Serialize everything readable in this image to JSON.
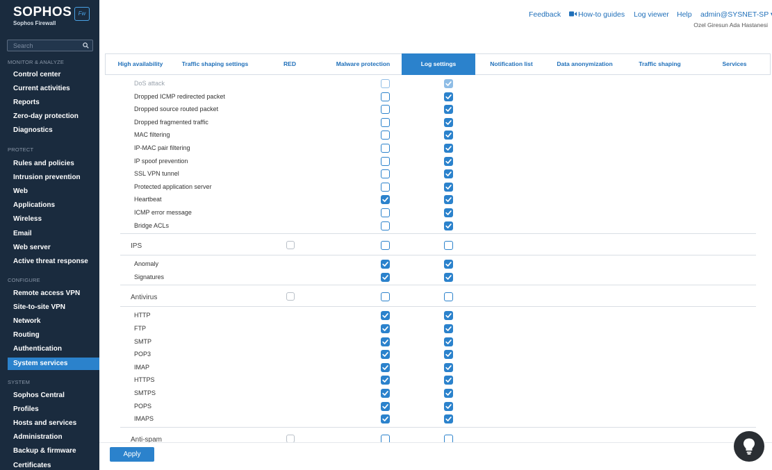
{
  "brand": {
    "name": "SOPHOS",
    "product": "Sophos Firewall",
    "badge": "Fw"
  },
  "search": {
    "placeholder": "Search"
  },
  "sidebar": {
    "sections": [
      {
        "label": "MONITOR & ANALYZE",
        "items": [
          "Control center",
          "Current activities",
          "Reports",
          "Zero-day protection",
          "Diagnostics"
        ]
      },
      {
        "label": "PROTECT",
        "items": [
          "Rules and policies",
          "Intrusion prevention",
          "Web",
          "Applications",
          "Wireless",
          "Email",
          "Web server",
          "Active threat response"
        ]
      },
      {
        "label": "CONFIGURE",
        "items": [
          "Remote access VPN",
          "Site-to-site VPN",
          "Network",
          "Routing",
          "Authentication",
          "System services"
        ]
      },
      {
        "label": "SYSTEM",
        "items": [
          "Sophos Central",
          "Profiles",
          "Hosts and services",
          "Administration",
          "Backup & firmware",
          "Certificates"
        ]
      }
    ],
    "active_item": "System services"
  },
  "header": {
    "links": [
      "Feedback",
      "How-to guides",
      "Log viewer",
      "Help",
      "admin@SYSNET-SP ▾"
    ],
    "subtitle": "Ozel Giresun Ada Hastanesi"
  },
  "tabs": [
    "High availability",
    "Traffic shaping settings",
    "RED",
    "Malware protection",
    "Log settings",
    "Notification list",
    "Data anonymization",
    "Traffic shaping",
    "Services"
  ],
  "active_tab": "Log settings",
  "rows": [
    {
      "label": "DoS attack",
      "type": "item",
      "c1": null,
      "c2": false,
      "c3": true,
      "faded": true
    },
    {
      "label": "Dropped ICMP redirected packet",
      "type": "item",
      "c1": null,
      "c2": false,
      "c3": true
    },
    {
      "label": "Dropped source routed packet",
      "type": "item",
      "c1": null,
      "c2": false,
      "c3": true
    },
    {
      "label": "Dropped fragmented traffic",
      "type": "item",
      "c1": null,
      "c2": false,
      "c3": true
    },
    {
      "label": "MAC filtering",
      "type": "item",
      "c1": null,
      "c2": false,
      "c3": true
    },
    {
      "label": "IP-MAC pair filtering",
      "type": "item",
      "c1": null,
      "c2": false,
      "c3": true
    },
    {
      "label": "IP spoof prevention",
      "type": "item",
      "c1": null,
      "c2": false,
      "c3": true
    },
    {
      "label": "SSL VPN tunnel",
      "type": "item",
      "c1": null,
      "c2": false,
      "c3": true
    },
    {
      "label": "Protected application server",
      "type": "item",
      "c1": null,
      "c2": false,
      "c3": true
    },
    {
      "label": "Heartbeat",
      "type": "item",
      "c1": null,
      "c2": true,
      "c3": true
    },
    {
      "label": "ICMP error message",
      "type": "item",
      "c1": null,
      "c2": false,
      "c3": true
    },
    {
      "label": "Bridge ACLs",
      "type": "item",
      "c1": null,
      "c2": false,
      "c3": true
    },
    {
      "label": "IPS",
      "type": "category",
      "c1": false,
      "c2": false,
      "c3": false
    },
    {
      "label": "Anomaly",
      "type": "item",
      "c1": null,
      "c2": true,
      "c3": true
    },
    {
      "label": "Signatures",
      "type": "item",
      "c1": null,
      "c2": true,
      "c3": true
    },
    {
      "label": "Antivirus",
      "type": "category",
      "c1": false,
      "c2": false,
      "c3": false
    },
    {
      "label": "HTTP",
      "type": "item",
      "c1": null,
      "c2": true,
      "c3": true
    },
    {
      "label": "FTP",
      "type": "item",
      "c1": null,
      "c2": true,
      "c3": true
    },
    {
      "label": "SMTP",
      "type": "item",
      "c1": null,
      "c2": true,
      "c3": true
    },
    {
      "label": "POP3",
      "type": "item",
      "c1": null,
      "c2": true,
      "c3": true
    },
    {
      "label": "IMAP",
      "type": "item",
      "c1": null,
      "c2": true,
      "c3": true
    },
    {
      "label": "HTTPS",
      "type": "item",
      "c1": null,
      "c2": true,
      "c3": true
    },
    {
      "label": "SMTPS",
      "type": "item",
      "c1": null,
      "c2": true,
      "c3": true
    },
    {
      "label": "POPS",
      "type": "item",
      "c1": null,
      "c2": true,
      "c3": true
    },
    {
      "label": "IMAPS",
      "type": "item",
      "c1": null,
      "c2": true,
      "c3": true
    },
    {
      "label": "Anti-spam",
      "type": "category",
      "c1": false,
      "c2": false,
      "c3": false
    }
  ],
  "footer": {
    "apply_label": "Apply"
  },
  "colors": {
    "sidebar": "#1a2b3e",
    "accent": "#2b82cc",
    "link": "#1f6fb9"
  },
  "icons": {
    "search": "search-icon",
    "camera": "video-camera-icon",
    "help": "lightbulb-icon",
    "check": "check-icon"
  }
}
